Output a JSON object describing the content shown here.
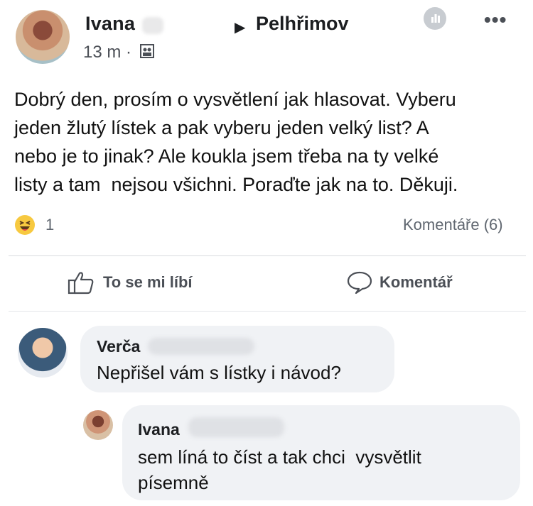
{
  "post": {
    "author": "Ivana",
    "group": "Pelhřimov",
    "time": "13 m ·",
    "text": "Dobrý den, prosím o vysvětlení jak hlasovat. Vyberu\njeden žlutý lístek a pak vyberu jeden velký list? A\nnebo je to jinak? Ale koukla jsem třeba na ty velké\nlisty a tam  nejsou všichni. Poraďte jak na to. Děkuji.",
    "reaction_count": "1",
    "comments_count": "Komentáře (6)"
  },
  "actions": {
    "like": "To se mi líbí",
    "comment": "Komentář"
  },
  "comments": [
    {
      "author": "Verča",
      "text": "Nepřišel vám s lístky i návod?"
    },
    {
      "author": "Ivana",
      "text": "sem líná to číst a tak chci  vysvětlit\npísemně"
    }
  ],
  "icons": {
    "more": "more-icon",
    "stats": "stats-icon",
    "audience": "audience-icon",
    "reaction": "haha-icon",
    "like": "thumbs-up-icon",
    "comment": "comment-bubble-icon"
  },
  "colors": {
    "bubble": "#f0f2f5",
    "text_secondary": "#606770"
  }
}
